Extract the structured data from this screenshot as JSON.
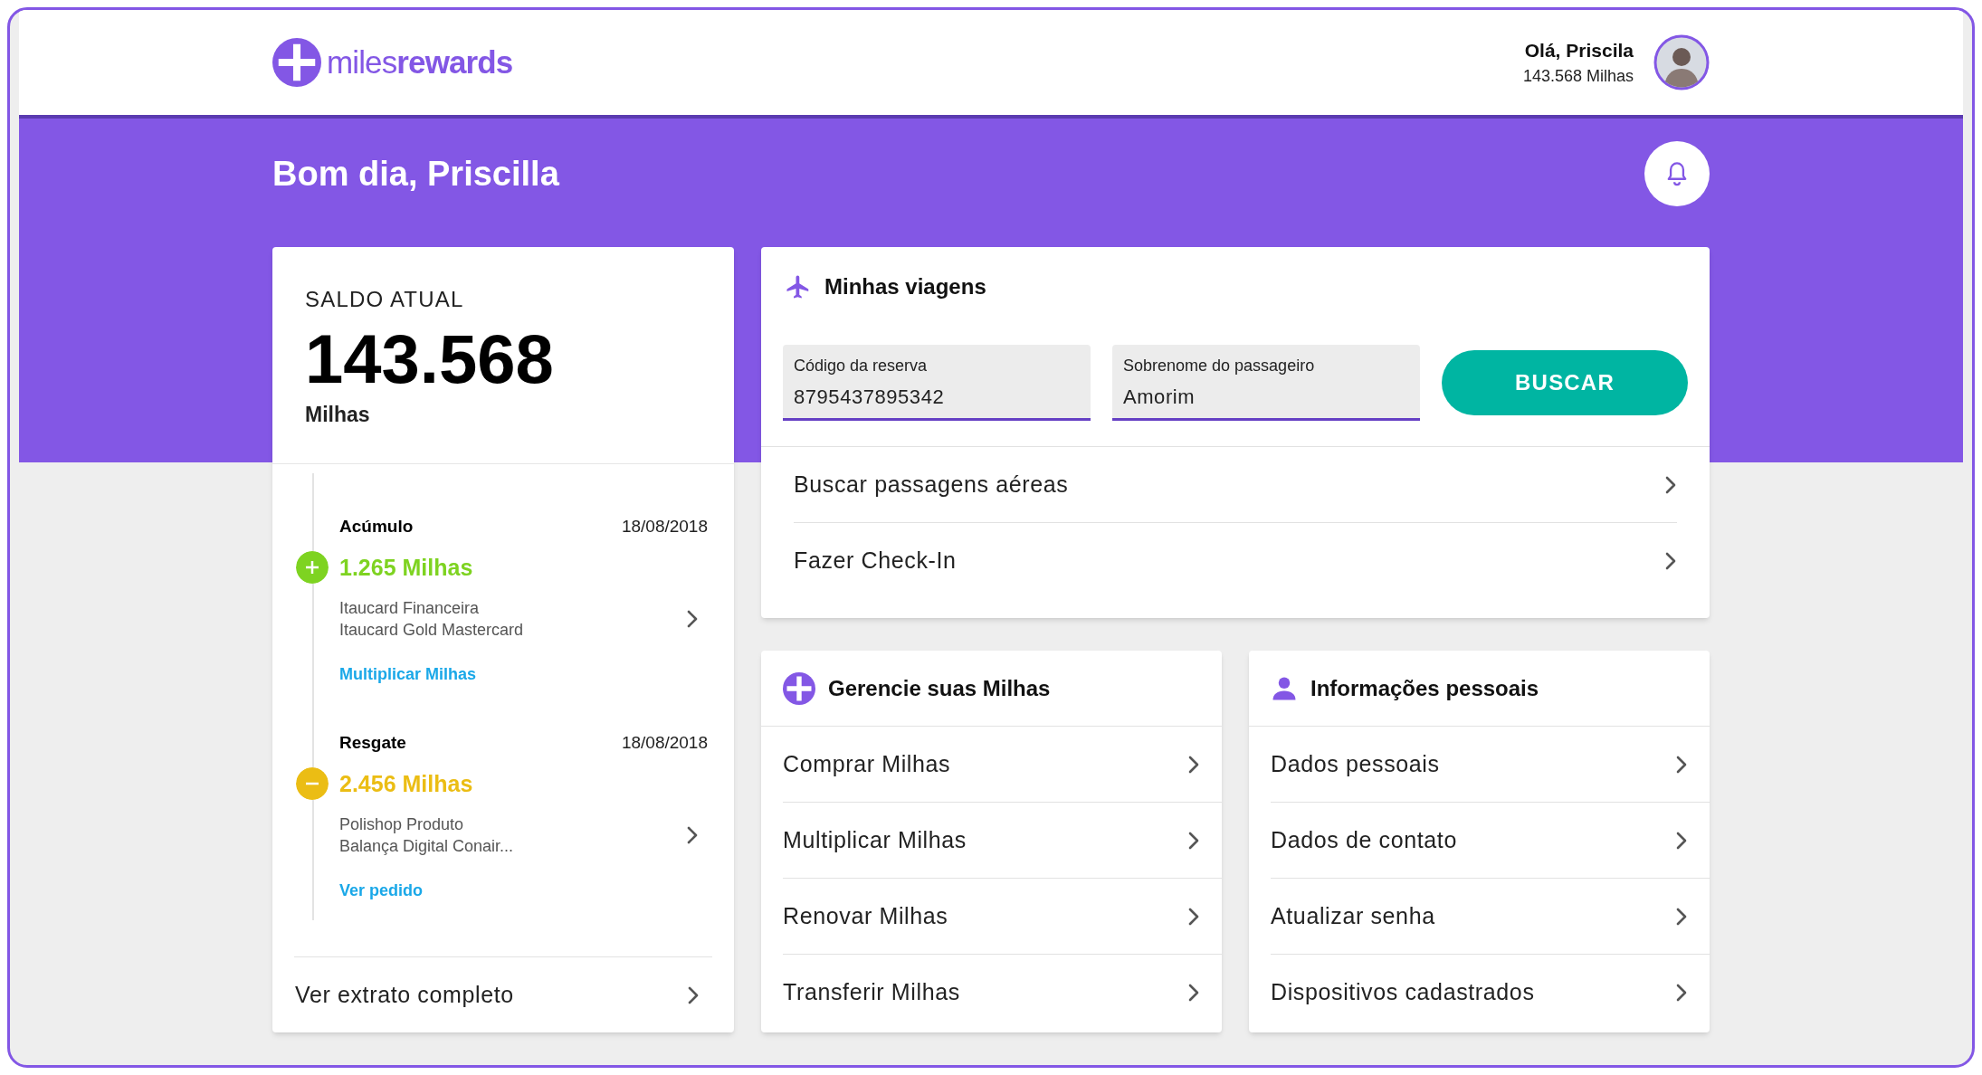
{
  "header": {
    "logo_light": "miles",
    "logo_bold": "rewards",
    "greeting": "Olá, Priscila",
    "balance": "143.568 Milhas"
  },
  "banner": {
    "title": "Bom dia, Priscilla"
  },
  "balance_card": {
    "label": "SALDO ATUAL",
    "amount": "143.568",
    "unit": "Milhas",
    "events": [
      {
        "kind": "plus",
        "type": "Acúmulo",
        "date": "18/08/2018",
        "amount": "1.265 Milhas",
        "color": "#7ed321",
        "lines": [
          "Itaucard Financeira",
          "Itaucard Gold Mastercard"
        ],
        "link": "Multiplicar Milhas"
      },
      {
        "kind": "minus",
        "type": "Resgate",
        "date": "18/08/2018",
        "amount": "2.456 Milhas",
        "color": "#ebbd14",
        "lines": [
          "Polishop Produto",
          "Balança Digital Conair..."
        ],
        "link": "Ver pedido"
      }
    ],
    "footer": "Ver extrato completo"
  },
  "trips": {
    "title": "Minhas viagens",
    "fields": [
      {
        "label": "Código da reserva",
        "value": "8795437895342"
      },
      {
        "label": "Sobrenome do passageiro",
        "value": "Amorim"
      }
    ],
    "button": "BUSCAR",
    "items": [
      "Buscar passagens aéreas",
      "Fazer Check-In"
    ]
  },
  "miles": {
    "title": "Gerencie suas Milhas",
    "items": [
      "Comprar Milhas",
      "Multiplicar Milhas",
      "Renovar Milhas",
      "Transferir Milhas"
    ]
  },
  "personal": {
    "title": "Informações pessoais",
    "items": [
      "Dados pessoais",
      "Dados de contato",
      "Atualizar senha",
      "Dispositivos cadastrados"
    ]
  }
}
